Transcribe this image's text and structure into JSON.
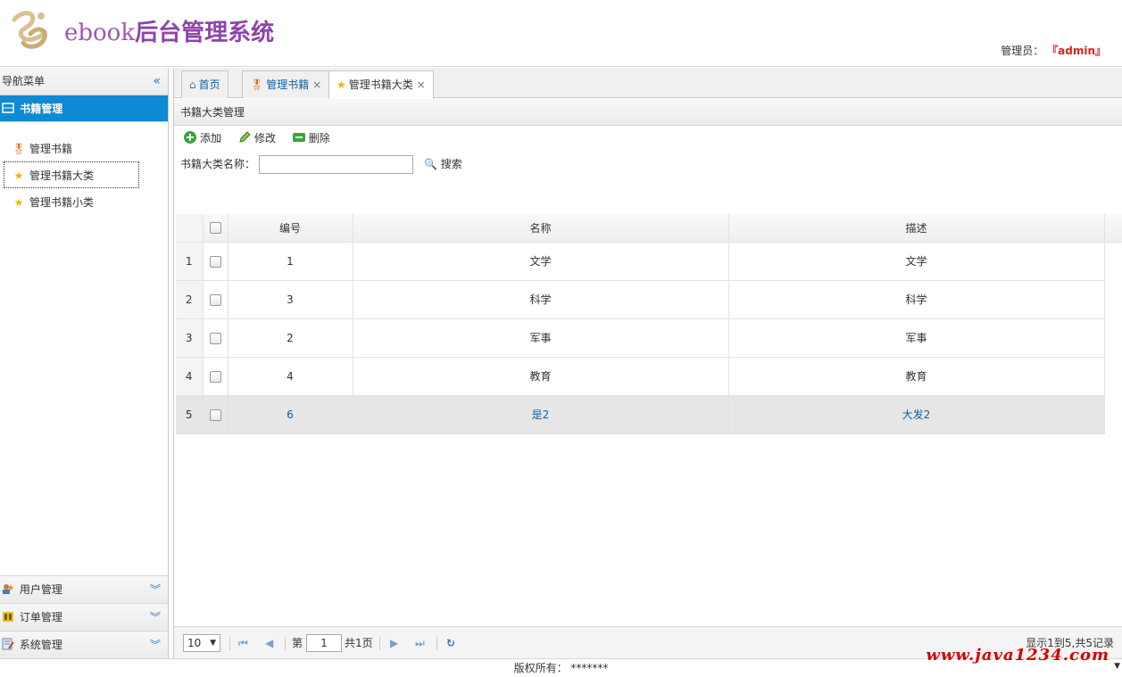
{
  "header": {
    "logo_en": "ebook",
    "logo_cn": "后台管理系统",
    "admin_label": "管理员：",
    "admin_name": "『admin』"
  },
  "sidebar": {
    "title": "导航菜单",
    "active_panel": "书籍管理",
    "items": [
      {
        "label": "管理书籍",
        "icon": "award-icon"
      },
      {
        "label": "管理书籍大类",
        "icon": "star-icon"
      },
      {
        "label": "管理书籍小类",
        "icon": "star-icon"
      }
    ],
    "bottom_panels": [
      {
        "label": "用户管理",
        "icon": "users-icon"
      },
      {
        "label": "订单管理",
        "icon": "order-icon"
      },
      {
        "label": "系统管理",
        "icon": "settings-icon"
      }
    ]
  },
  "tabs": [
    {
      "label": "首页",
      "icon": "home-icon"
    },
    {
      "label": "管理书籍",
      "icon": "award-icon"
    },
    {
      "label": "管理书籍大类",
      "icon": "star-icon"
    }
  ],
  "panel": {
    "title": "书籍大类管理",
    "toolbar": {
      "add": "添加",
      "edit": "修改",
      "delete": "删除"
    },
    "search_label": "书籍大类名称：",
    "search_value": "",
    "search_button": "搜索"
  },
  "table": {
    "columns": [
      "编号",
      "名称",
      "描述"
    ],
    "rows": [
      {
        "num": "1",
        "id": "1",
        "name": "文学",
        "desc": "文学"
      },
      {
        "num": "2",
        "id": "3",
        "name": "科学",
        "desc": "科学"
      },
      {
        "num": "3",
        "id": "2",
        "name": "军事",
        "desc": "军事"
      },
      {
        "num": "4",
        "id": "4",
        "name": "教育",
        "desc": "教育"
      },
      {
        "num": "5",
        "id": "6",
        "name": "是2",
        "desc": "大发2"
      }
    ]
  },
  "pager": {
    "page_size": "10",
    "page_prefix": "第",
    "current_page": "1",
    "total_pages": "共1页",
    "info": "显示1到5,共5记录"
  },
  "footer": {
    "copyright": "版权所有： *******",
    "watermark": "www.java1234.com"
  },
  "colors": {
    "accent": "#0d8ad1",
    "logo": "#8e44ad",
    "admin": "#e02020",
    "watermark": "#d40000"
  }
}
